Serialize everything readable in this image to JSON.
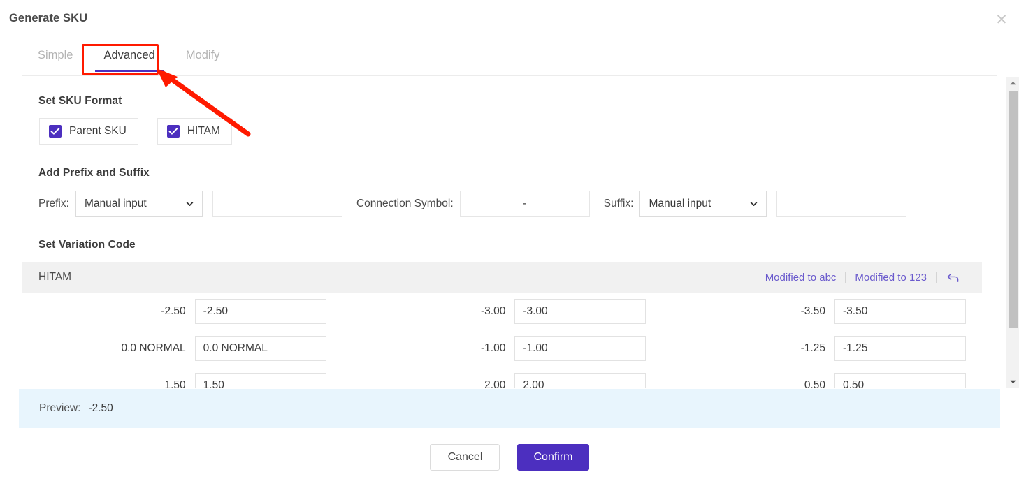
{
  "dialog": {
    "title": "Generate SKU",
    "close_icon": "close-icon"
  },
  "tabs": [
    {
      "label": "Simple",
      "active": false
    },
    {
      "label": "Advanced",
      "active": true
    },
    {
      "label": "Modify",
      "active": false
    }
  ],
  "sections": {
    "sku_format": {
      "title": "Set SKU Format",
      "options": [
        {
          "label": "Parent SKU",
          "checked": true
        },
        {
          "label": "HITAM",
          "checked": true
        }
      ]
    },
    "prefix_suffix": {
      "title": "Add Prefix and Suffix",
      "prefix_label": "Prefix:",
      "prefix_select_value": "Manual input",
      "prefix_input_value": "",
      "prefix_input_placeholder": "",
      "connection_label": "Connection Symbol:",
      "connection_value": "-",
      "suffix_label": "Suffix:",
      "suffix_select_value": "Manual input",
      "suffix_input_value": "",
      "suffix_input_placeholder": ""
    },
    "variation_code": {
      "title": "Set Variation Code",
      "group_name": "HITAM",
      "action_abc": "Modified to abc",
      "action_123": "Modified to 123",
      "undo_icon": "undo-arrow-icon",
      "rows": [
        [
          {
            "name": "-2.50",
            "value": "-2.50"
          },
          {
            "name": "-3.00",
            "value": "-3.00"
          },
          {
            "name": "-3.50",
            "value": "-3.50"
          }
        ],
        [
          {
            "name": "0.0 NORMAL",
            "value": "0.0 NORMAL"
          },
          {
            "name": "-1.00",
            "value": "-1.00"
          },
          {
            "name": "-1.25",
            "value": "-1.25"
          }
        ],
        [
          {
            "name": "1.50",
            "value": "1.50"
          },
          {
            "name": "2.00",
            "value": "2.00"
          },
          {
            "name": "0.50",
            "value": "0.50"
          }
        ]
      ]
    }
  },
  "preview": {
    "label": "Preview:",
    "value": "-2.50"
  },
  "footer": {
    "cancel_label": "Cancel",
    "confirm_label": "Confirm"
  },
  "scrollbar": {
    "up_icon": "scroll-up-arrow-icon",
    "down_icon": "scroll-down-arrow-icon"
  },
  "annotation": {
    "highlight_color": "#ff1a00",
    "target": "Advanced"
  },
  "colors": {
    "accent": "#4c2fbf",
    "link": "#6a5acd",
    "preview_bg": "#e8f5fd",
    "table_head_bg": "#f1f1f1"
  }
}
